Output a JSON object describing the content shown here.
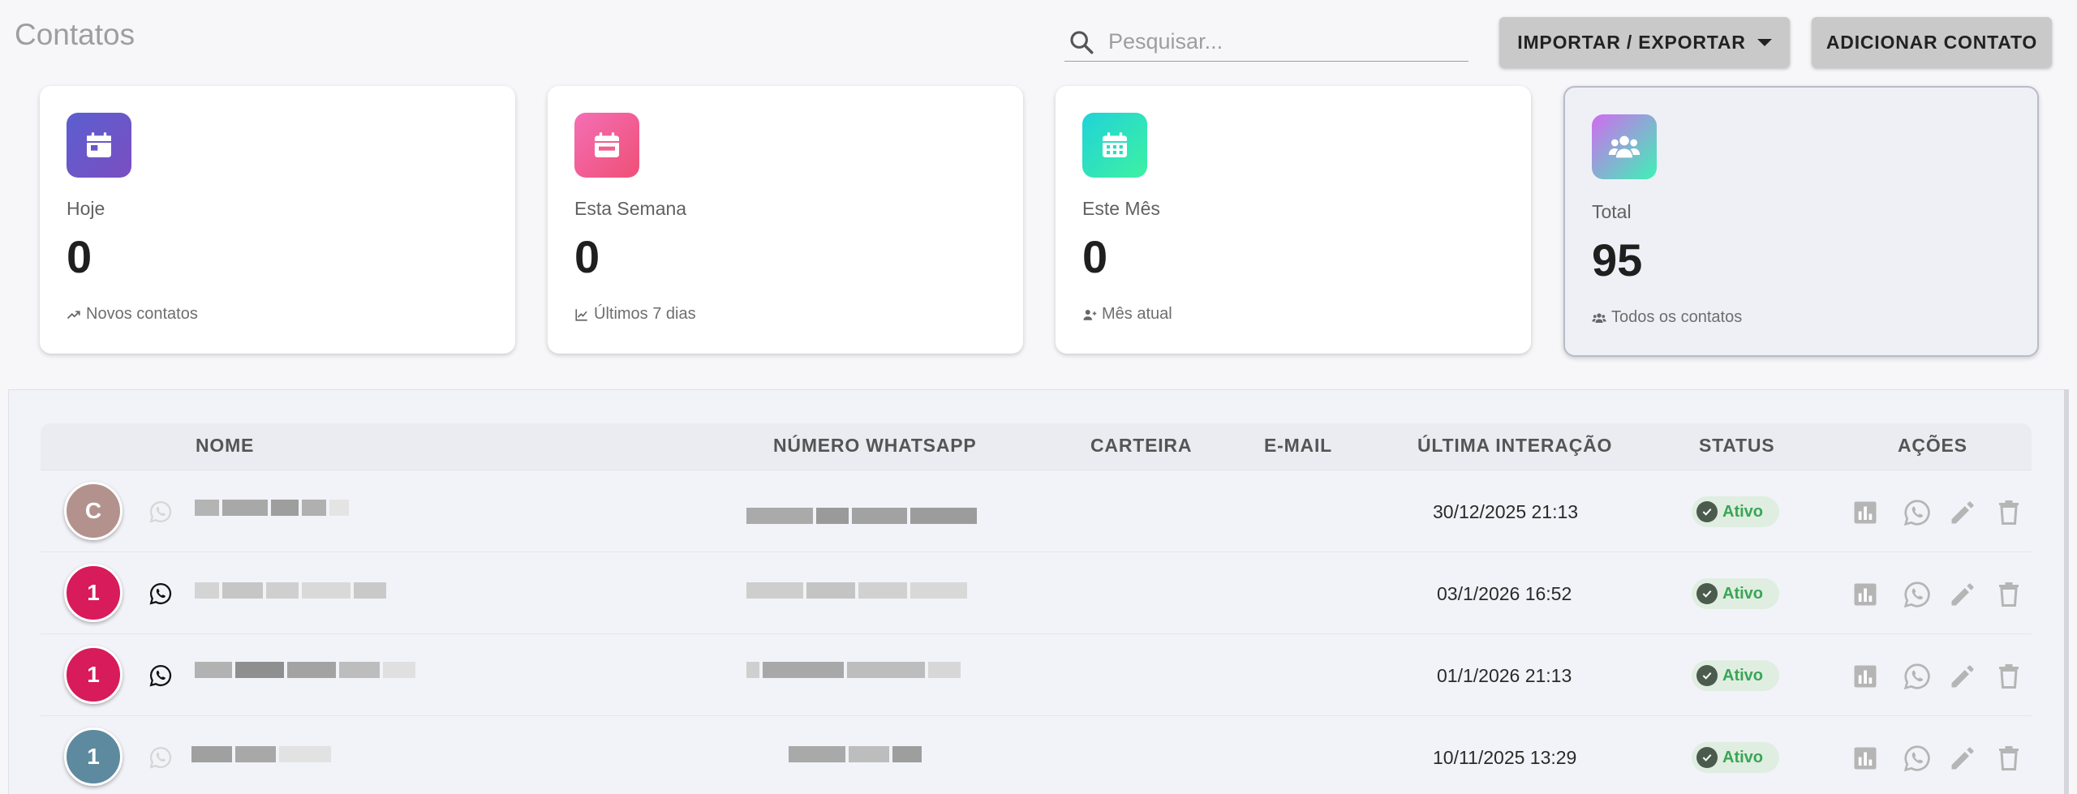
{
  "header": {
    "title": "Contatos",
    "search_placeholder": "Pesquisar...",
    "import_export_label": "IMPORTAR / EXPORTAR",
    "add_contact_label": "ADICIONAR CONTATO"
  },
  "cards": [
    {
      "label": "Hoje",
      "value": "0",
      "sub": "Novos contatos",
      "icon": "calendar-icon",
      "colors": [
        "#5b5fd0",
        "#7b4ec1"
      ]
    },
    {
      "label": "Esta Semana",
      "value": "0",
      "sub": "Últimos 7 dias",
      "icon": "calendar-week-icon",
      "colors": [
        "#f46fb5",
        "#ef4f76"
      ]
    },
    {
      "label": "Este Mês",
      "value": "0",
      "sub": "Mês atual",
      "icon": "calendar-month-icon",
      "colors": [
        "#20d3d8",
        "#3ef1a2"
      ]
    },
    {
      "label": "Total",
      "value": "95",
      "sub": "Todos os contatos",
      "icon": "users-icon",
      "colors": [
        "#d16bf0",
        "#3df2b5"
      ]
    }
  ],
  "table": {
    "headers": {
      "name": "NOME",
      "whatsapp": "NÚMERO WHATSAPP",
      "wallet": "CARTEIRA",
      "email": "E-MAIL",
      "last_interaction": "ÚLTIMA INTERAÇÃO",
      "status": "STATUS",
      "actions": "AÇÕES"
    },
    "rows": [
      {
        "initial": "C",
        "avatar_color": "#b3928d",
        "whatsapp_active": false,
        "last_interaction": "30/12/2025 21:13",
        "status": "Ativo"
      },
      {
        "initial": "1",
        "avatar_color": "#d81b5a",
        "whatsapp_active": true,
        "last_interaction": "03/1/2026 16:52",
        "status": "Ativo"
      },
      {
        "initial": "1",
        "avatar_color": "#d81b5a",
        "whatsapp_active": true,
        "last_interaction": "01/1/2026 21:13",
        "status": "Ativo"
      },
      {
        "initial": "1",
        "avatar_color": "#5e8aa0",
        "whatsapp_active": false,
        "last_interaction": "10/11/2025 13:29",
        "status": "Ativo"
      }
    ]
  }
}
